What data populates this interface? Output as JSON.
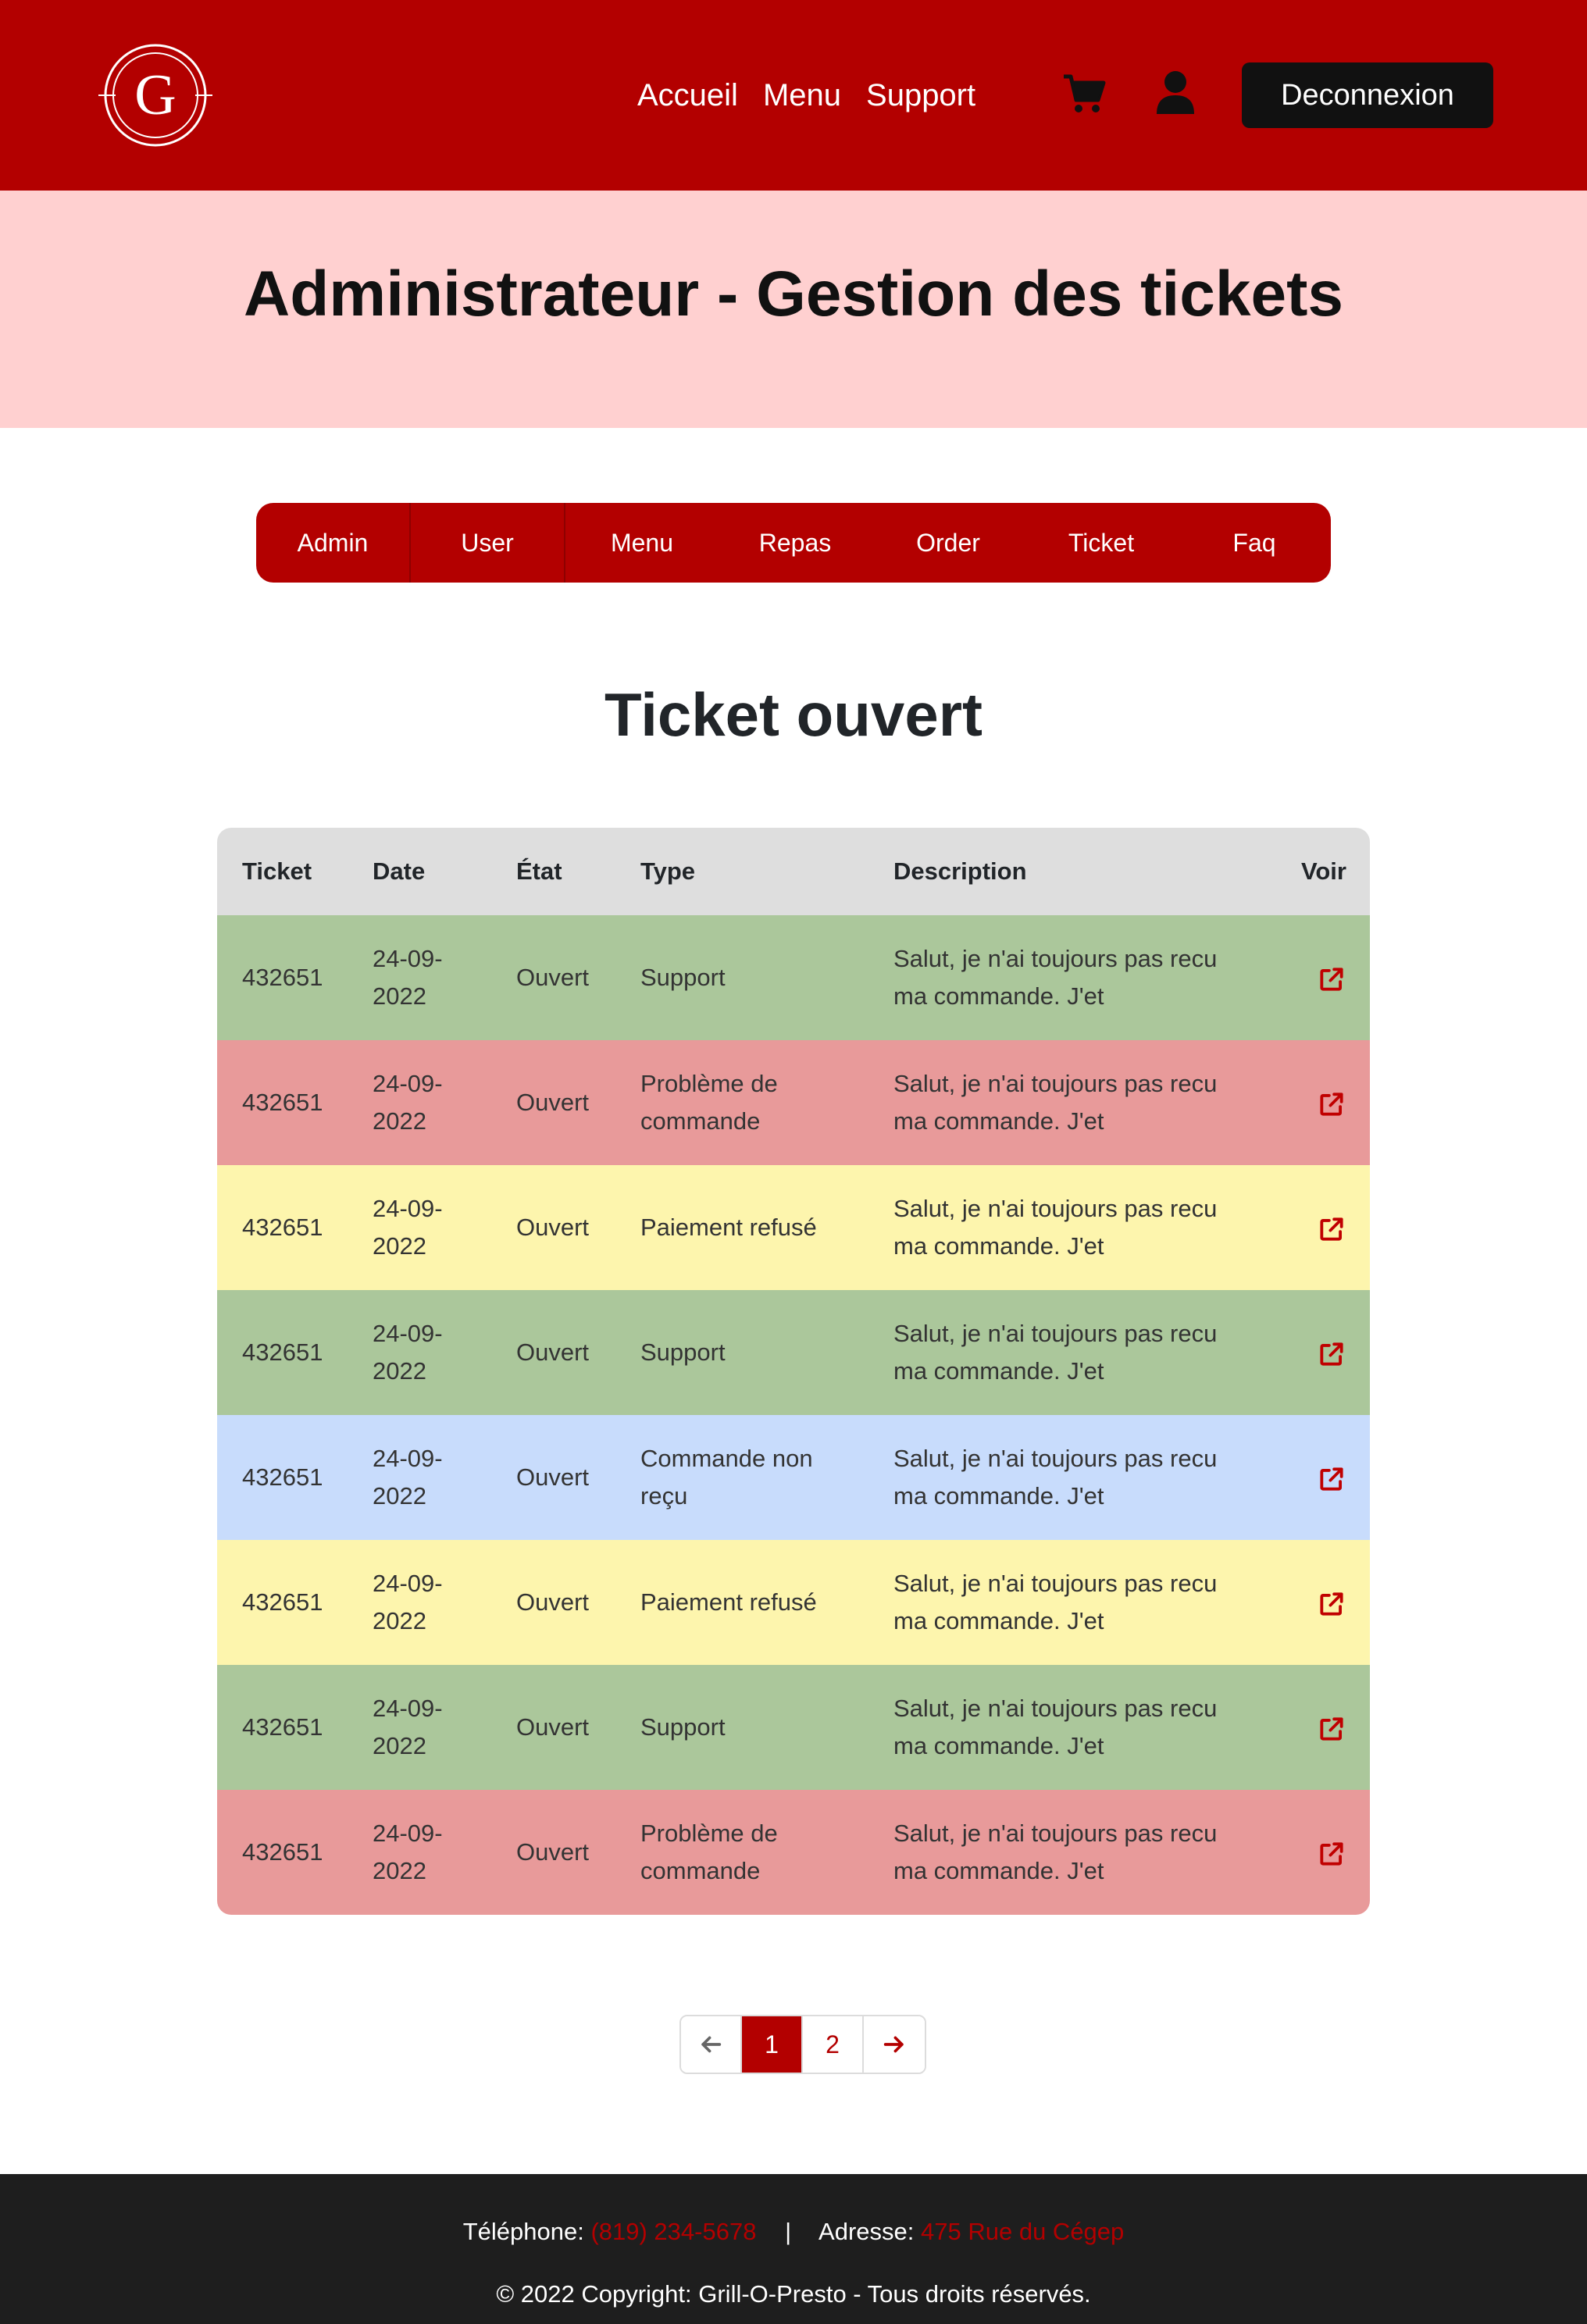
{
  "header": {
    "logo_letter": "G",
    "nav": [
      "Accueil",
      "Menu",
      "Support"
    ],
    "cart_icon": "shopping-cart-icon",
    "user_icon": "user-icon",
    "logout_label": "Deconnexion",
    "brand_color": "#b30000"
  },
  "banner": {
    "title": "Administrateur - Gestion des tickets",
    "background": "#ffd0d0"
  },
  "admin_menu": [
    "Admin",
    "User",
    "Menu",
    "Repas",
    "Order",
    "Ticket",
    "Faq"
  ],
  "section_title": "Ticket ouvert",
  "table": {
    "headers": [
      "Ticket",
      "Date",
      "État",
      "Type",
      "Description",
      "Voir"
    ],
    "rows": [
      {
        "ticket": "432651",
        "date_a": "24-09-",
        "date_b": "2022",
        "state": "Ouvert",
        "type": "Support",
        "desc_a": "Salut, je n'ai toujours pas recu",
        "desc_b": "ma commande. J'et",
        "color": "green"
      },
      {
        "ticket": "432651",
        "date_a": "24-09-",
        "date_b": "2022",
        "state": "Ouvert",
        "type": "Problème de commande",
        "desc_a": "Salut, je n'ai toujours pas recu",
        "desc_b": "ma commande. J'et",
        "color": "red"
      },
      {
        "ticket": "432651",
        "date_a": "24-09-",
        "date_b": "2022",
        "state": "Ouvert",
        "type": "Paiement refusé",
        "desc_a": "Salut, je n'ai toujours pas recu",
        "desc_b": "ma commande. J'et",
        "color": "yellow"
      },
      {
        "ticket": "432651",
        "date_a": "24-09-",
        "date_b": "2022",
        "state": "Ouvert",
        "type": "Support",
        "desc_a": "Salut, je n'ai toujours pas recu",
        "desc_b": "ma commande. J'et",
        "color": "green"
      },
      {
        "ticket": "432651",
        "date_a": "24-09-",
        "date_b": "2022",
        "state": "Ouvert",
        "type": "Commande non reçu",
        "desc_a": "Salut, je n'ai toujours pas recu",
        "desc_b": "ma commande. J'et",
        "color": "blue"
      },
      {
        "ticket": "432651",
        "date_a": "24-09-",
        "date_b": "2022",
        "state": "Ouvert",
        "type": "Paiement refusé",
        "desc_a": "Salut, je n'ai toujours pas recu",
        "desc_b": "ma commande. J'et",
        "color": "yellow"
      },
      {
        "ticket": "432651",
        "date_a": "24-09-",
        "date_b": "2022",
        "state": "Ouvert",
        "type": "Support",
        "desc_a": "Salut, je n'ai toujours pas recu",
        "desc_b": "ma commande. J'et",
        "color": "green"
      },
      {
        "ticket": "432651",
        "date_a": "24-09-",
        "date_b": "2022",
        "state": "Ouvert",
        "type": "Problème de commande",
        "desc_a": "Salut, je n'ai toujours pas recu",
        "desc_b": "ma commande. J'et",
        "color": "red"
      }
    ],
    "voir_icon": "external-link-icon"
  },
  "pagination": {
    "prev_icon": "arrow-left-icon",
    "pages": [
      "1",
      "2"
    ],
    "active_page": "1",
    "next_icon": "arrow-right-icon"
  },
  "footer": {
    "phone_label": "Téléphone:",
    "phone": "(819) 234-5678",
    "separator": "|",
    "address_label": "Adresse:",
    "address": "475 Rue du Cégep",
    "copyright": "© 2022 Copyright: Grill-O-Presto - Tous droits réservés."
  }
}
